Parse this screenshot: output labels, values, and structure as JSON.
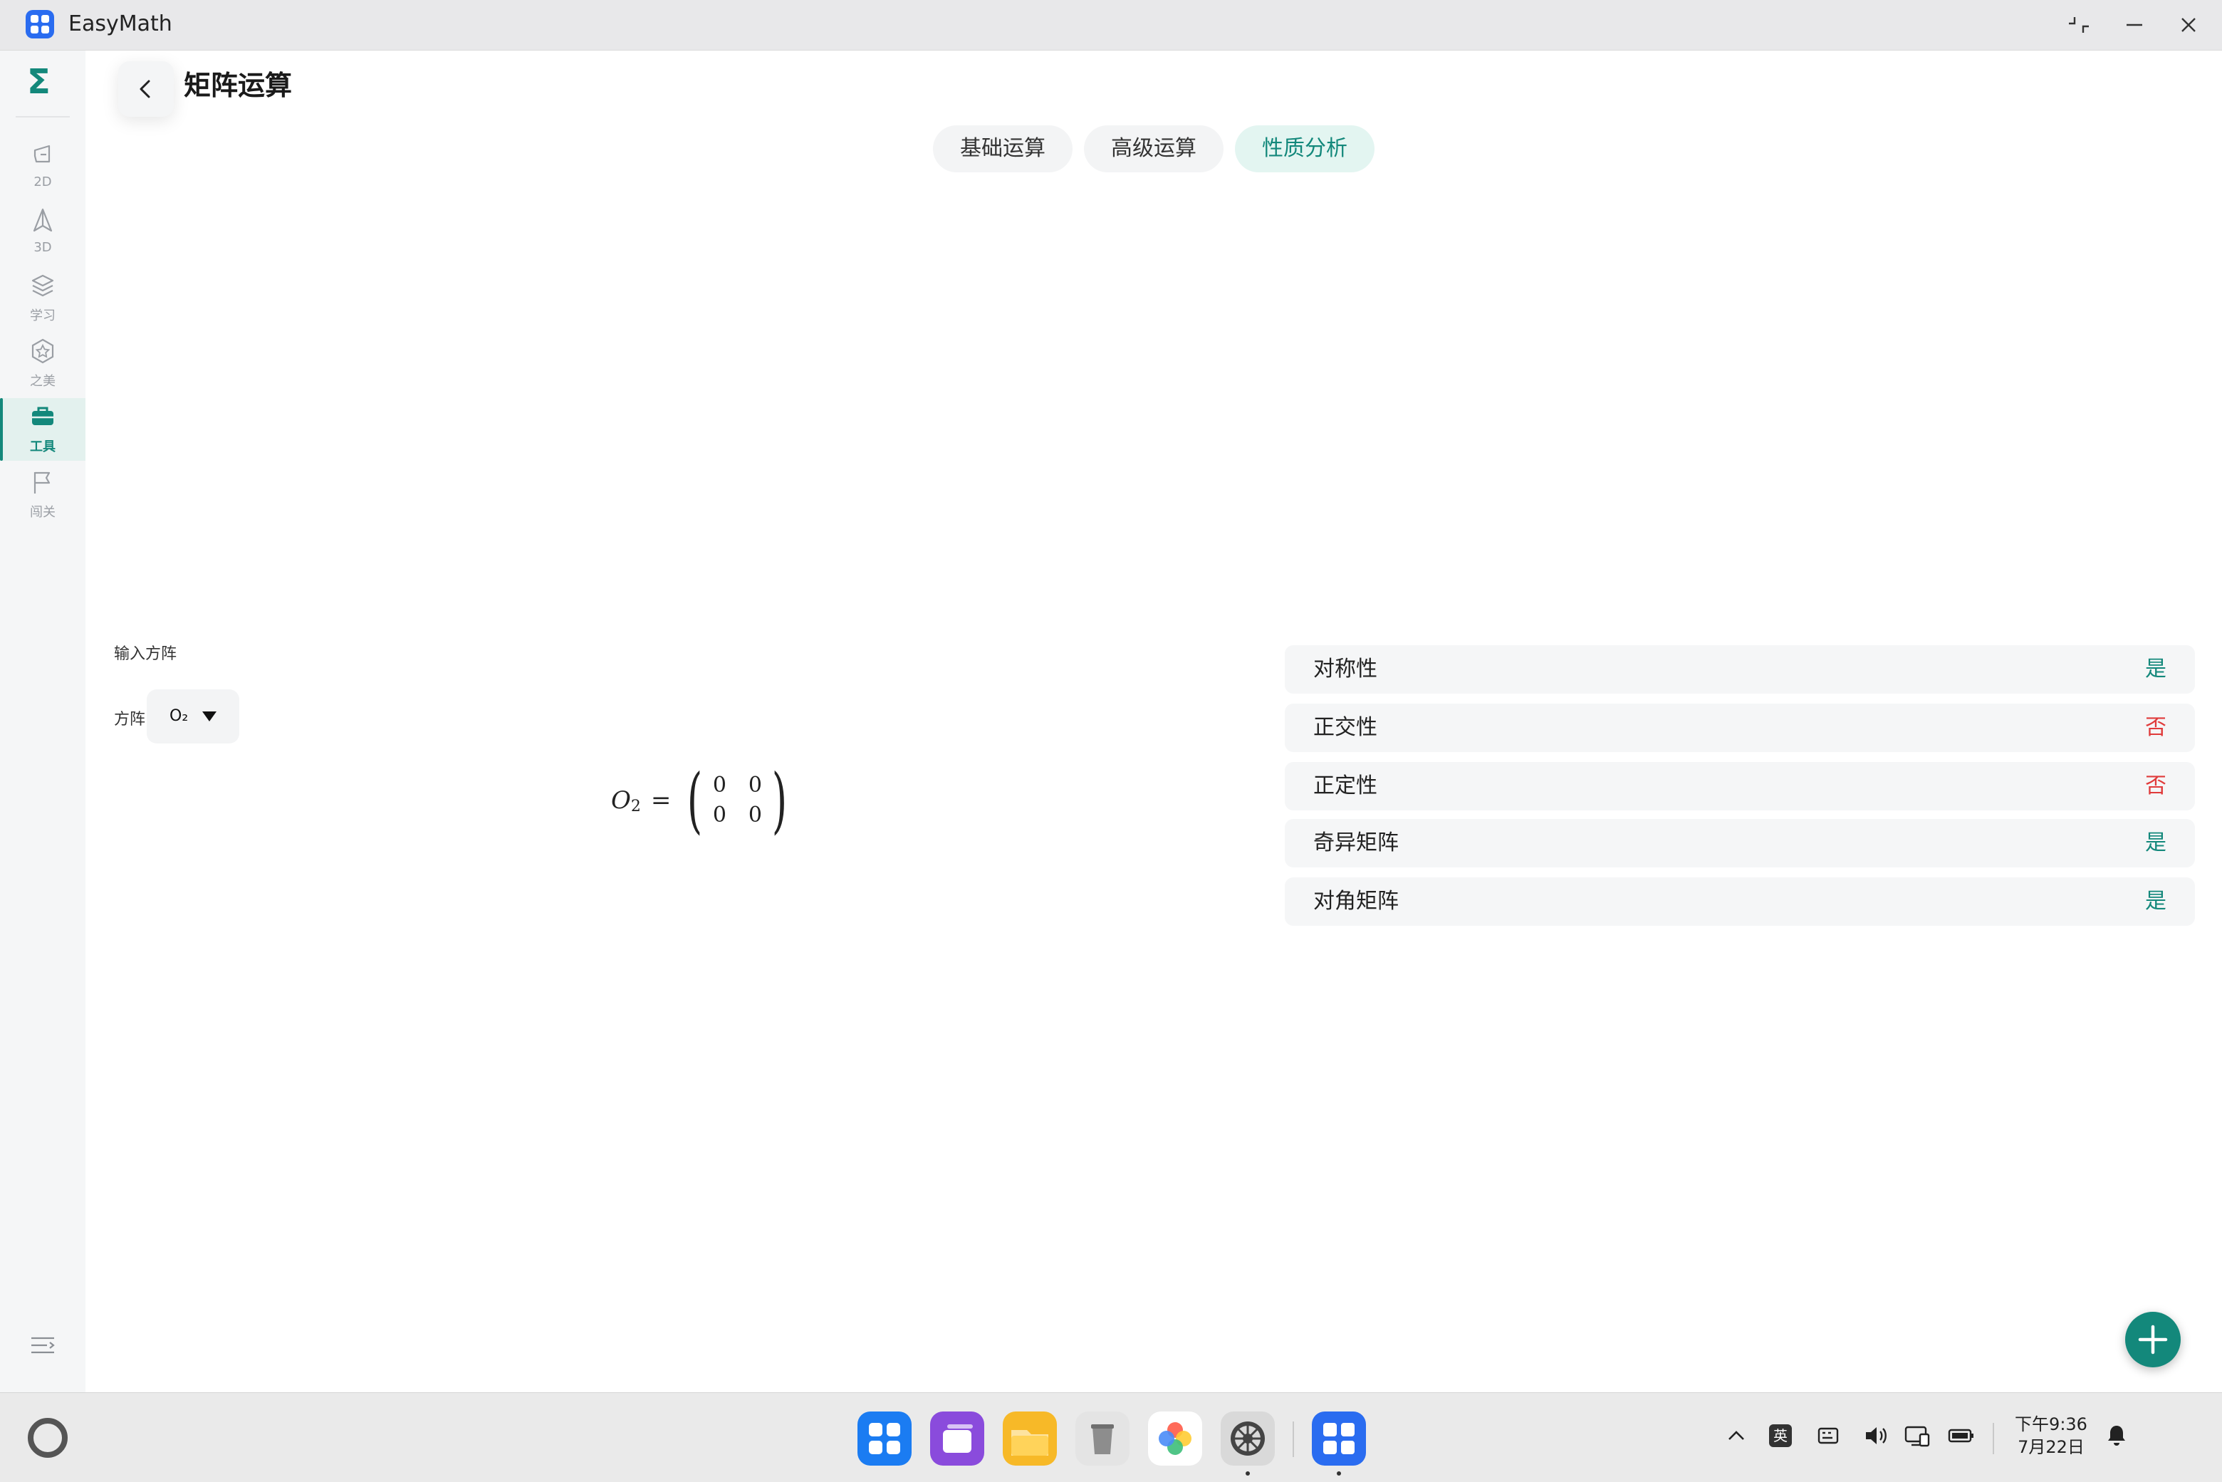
{
  "window": {
    "app_title": "EasyMath",
    "controls": [
      "restore-icon",
      "minimize-icon",
      "close-icon"
    ]
  },
  "sidebar": {
    "logo_symbol": "Σ",
    "items": [
      {
        "label": "2D",
        "icon": "2d-shape-icon",
        "active": false
      },
      {
        "label": "3D",
        "icon": "3d-shape-icon",
        "active": false
      },
      {
        "label": "学习",
        "icon": "layers-icon",
        "active": false
      },
      {
        "label": "之美",
        "icon": "star-hexagon-icon",
        "active": false
      },
      {
        "label": "工具",
        "icon": "toolbox-icon",
        "active": true
      },
      {
        "label": "闯关",
        "icon": "flag-icon",
        "active": false
      }
    ]
  },
  "header": {
    "title": "矩阵运算"
  },
  "tabs": [
    {
      "label": "基础运算",
      "active": false
    },
    {
      "label": "高级运算",
      "active": false
    },
    {
      "label": "性质分析",
      "active": true
    }
  ],
  "input": {
    "section_label": "输入方阵",
    "matrix_label": "方阵",
    "selected_matrix": "O₂"
  },
  "formula": {
    "variable": "O",
    "subscript": "2",
    "equals": "=",
    "matrix": [
      [
        "0",
        "0"
      ],
      [
        "0",
        "0"
      ]
    ]
  },
  "properties": [
    {
      "name": "对称性",
      "value": "是",
      "positive": true
    },
    {
      "name": "正交性",
      "value": "否",
      "positive": false
    },
    {
      "name": "正定性",
      "value": "否",
      "positive": false
    },
    {
      "name": "奇异矩阵",
      "value": "是",
      "positive": true
    },
    {
      "name": "对角矩阵",
      "value": "是",
      "positive": true
    }
  ],
  "colors": {
    "accent": "#13887b",
    "positive": "#13887b",
    "negative": "#e03b3b",
    "row_background": "#f5f6f7"
  },
  "taskbar": {
    "apps": [
      "app-store-icon",
      "multitask-icon",
      "files-icon",
      "trash-icon",
      "gallery-icon",
      "settings-icon",
      "easymath-icon"
    ],
    "ime": "英",
    "time": "下午9:36",
    "date": "7月22日"
  }
}
